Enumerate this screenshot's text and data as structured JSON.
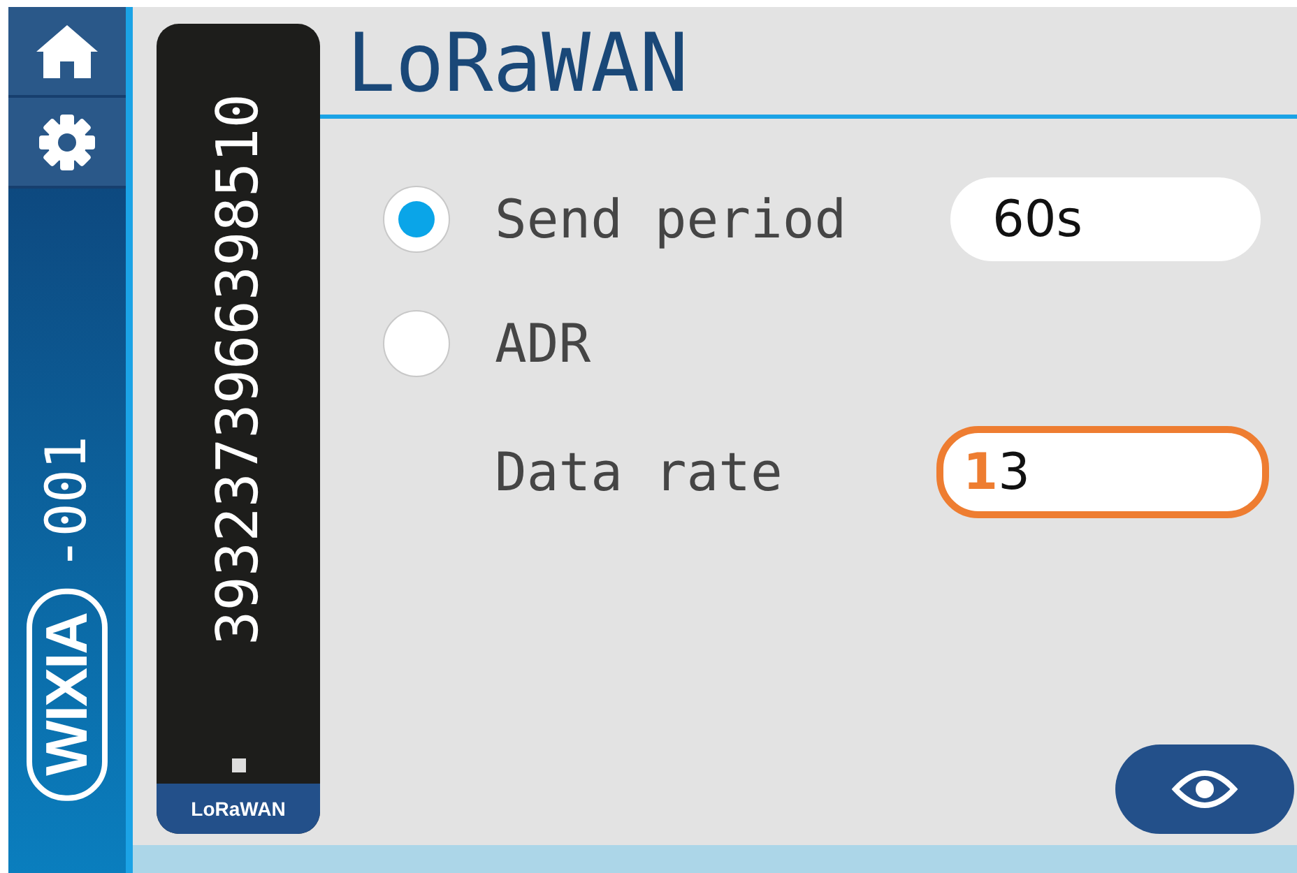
{
  "sidebar": {
    "nav_items": [
      {
        "kind": "home"
      },
      {
        "kind": "settings"
      }
    ],
    "brand": "WIXIA",
    "device_suffix": "-001"
  },
  "device_card": {
    "serial": "3932373966398510",
    "tag": "LoRaWAN"
  },
  "page": {
    "title": "LoRaWAN"
  },
  "settings": [
    {
      "kind": "radio",
      "label": "Send period",
      "selected": true,
      "value": "60s"
    },
    {
      "kind": "radio",
      "label": "ADR",
      "selected": false
    },
    {
      "kind": "field",
      "label": "Data rate",
      "value": "3",
      "highlighted": true,
      "annotation": "1"
    }
  ],
  "actions": [
    {
      "kind": "view"
    }
  ]
}
